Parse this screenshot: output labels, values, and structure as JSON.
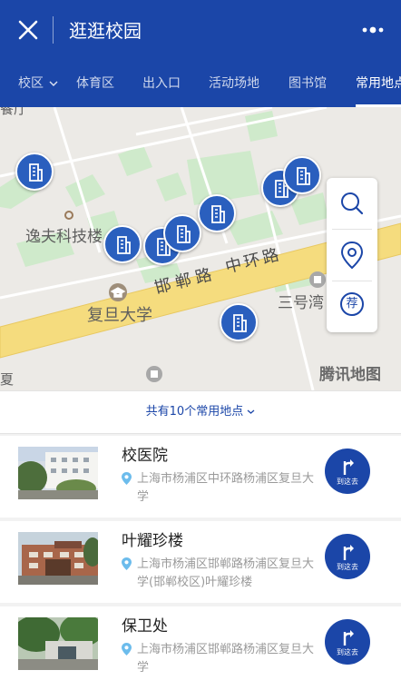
{
  "header": {
    "title": "逛逛校园",
    "close_icon": "close-icon",
    "more_icon": "more-icon"
  },
  "tabs": [
    {
      "label": "校区",
      "has_dropdown": true
    },
    {
      "label": "体育区"
    },
    {
      "label": "出入口"
    },
    {
      "label": "活动场地"
    },
    {
      "label": "图书馆"
    },
    {
      "label": "常用地点",
      "active": true
    }
  ],
  "map": {
    "labels": {
      "yifu": "逸夫科技楼",
      "handan_road": "邯郸路",
      "zhonghuan_road": "中环路",
      "fudan": "复旦大学",
      "sanhaowan": "三号湾",
      "top_left": "餐厅",
      "bottom_left": "夏"
    },
    "logo": "腾讯地图",
    "poi_icon": "building-icon",
    "controls": {
      "search_icon": "search-icon",
      "location_icon": "location-pin-icon",
      "recommend": "荐"
    }
  },
  "count_bar": {
    "text": "共有10个常用地点"
  },
  "places": [
    {
      "name": "校医院",
      "address": "上海市杨浦区中环路杨浦区复旦大学",
      "button": "到这去"
    },
    {
      "name": "叶耀珍楼",
      "address": "上海市杨浦区邯郸路杨浦区复旦大学(邯郸校区)叶耀珍楼",
      "button": "到这去"
    },
    {
      "name": "保卫处",
      "address": "上海市杨浦区邯郸路杨浦区复旦大学",
      "button": "到这去"
    }
  ],
  "colors": {
    "primary": "#1b46a8",
    "poi": "#2a5fbe",
    "road": "#f5dc7e",
    "greenery": "#cfeacb"
  }
}
